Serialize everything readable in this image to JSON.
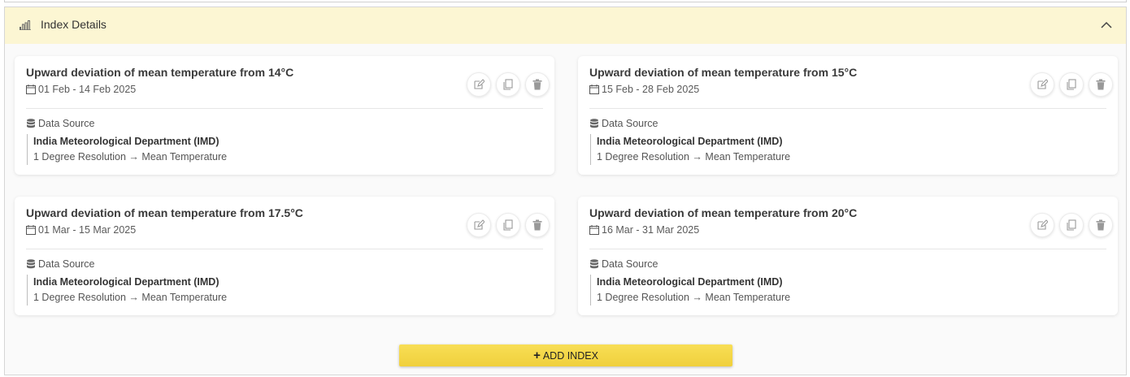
{
  "panel": {
    "title": "Index Details",
    "icons": {
      "header": "bar-chart-icon",
      "collapse": "chevron-up-icon"
    }
  },
  "cards": [
    {
      "title": "Upward deviation of mean temperature from 14°C",
      "date_range": "01 Feb - 14 Feb 2025",
      "data_source_label": "Data Source",
      "source_name": "India Meteorological Department (IMD)",
      "source_detail": "1 Degree Resolution → Mean Temperature"
    },
    {
      "title": "Upward deviation of mean temperature from 15°C",
      "date_range": "15 Feb - 28 Feb 2025",
      "data_source_label": "Data Source",
      "source_name": "India Meteorological Department (IMD)",
      "source_detail": "1 Degree Resolution → Mean Temperature"
    },
    {
      "title": "Upward deviation of mean temperature from 17.5°C",
      "date_range": "01 Mar - 15 Mar 2025",
      "data_source_label": "Data Source",
      "source_name": "India Meteorological Department (IMD)",
      "source_detail": "1 Degree Resolution → Mean Temperature"
    },
    {
      "title": "Upward deviation of mean temperature from 20°C",
      "date_range": "16 Mar - 31 Mar 2025",
      "data_source_label": "Data Source",
      "source_name": "India Meteorological Department (IMD)",
      "source_detail": "1 Degree Resolution → Mean Temperature"
    }
  ],
  "card_icons": [
    "calendar-icon",
    "database-icon",
    "edit-icon",
    "copy-icon",
    "trash-icon"
  ],
  "add_button": {
    "label": "ADD INDEX",
    "icon": "plus-icon",
    "color": "#f3d548"
  },
  "colors": {
    "header_bg": "#fcf6d3",
    "accent": "#f3d548"
  }
}
